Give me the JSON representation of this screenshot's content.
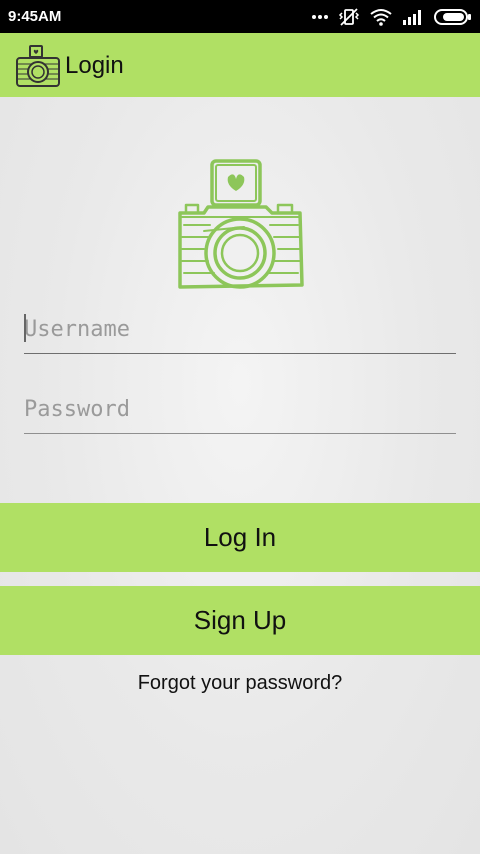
{
  "status_bar": {
    "time": "9:45AM",
    "icons": [
      "more-dots-icon",
      "vibrate-icon",
      "wifi-icon",
      "signal-icon",
      "battery-icon"
    ]
  },
  "app_bar": {
    "title": "Login",
    "icon": "camera-icon"
  },
  "logo": {
    "icon": "camera-heart-icon"
  },
  "form": {
    "username_placeholder": "Username",
    "username_value": "",
    "password_placeholder": "Password",
    "password_value": ""
  },
  "buttons": {
    "login_label": "Log In",
    "signup_label": "Sign Up"
  },
  "forgot_password": "Forgot your password?",
  "colors": {
    "accent": "#b0e064",
    "logo_stroke": "#8dc65a",
    "status_bar": "#000000",
    "background": "#ebebeb"
  }
}
